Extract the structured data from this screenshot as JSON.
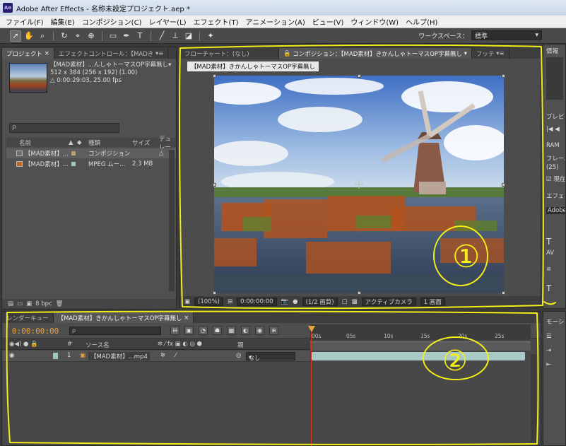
{
  "window": {
    "title": "Adobe After Effects - 名称未設定プロジェクト.aep *",
    "app_icon": "Ae"
  },
  "menu": [
    "ファイル(F)",
    "編集(E)",
    "コンポジション(C)",
    "レイヤー(L)",
    "エフェクト(T)",
    "アニメーション(A)",
    "ビュー(V)",
    "ウィンドウ(W)",
    "ヘルプ(H)"
  ],
  "toolbar": {
    "tools": [
      "selection-arrow",
      "hand",
      "zoom",
      "rotate",
      "camera",
      "pan-behind",
      "rectangle-mask",
      "pen",
      "text",
      "brush",
      "clone-stamp",
      "eraser",
      "puppet-pin"
    ],
    "workspace_label": "ワークスペース：",
    "workspace_value": "標準"
  },
  "project": {
    "tabs": [
      "プロジェクト",
      "エフェクトコントロール：【MADき"
    ],
    "selected_item": "【MAD素材】...んしゃトーマスOP字幕無し▾",
    "selected_dims": "512 x 384  (256 x 192) (1.00)",
    "selected_duration": "△ 0:00:29:03, 25.00 fps",
    "search_placeholder": "ρ",
    "columns": [
      "名前",
      "種類",
      "サイズ",
      "デュレー"
    ],
    "items": [
      {
        "name": "【MAD素材】...",
        "type": "コンポジション",
        "size": "",
        "dur": "△",
        "selected": true,
        "label_color": "#b8a06a"
      },
      {
        "name": "【MAD素材】...",
        "type": "MPEG ムー...",
        "size": "2.3 MB",
        "dur": "",
        "selected": false,
        "label_color": "#9fc7c4"
      }
    ],
    "bpc": "8 bpc"
  },
  "composition": {
    "tabs": [
      "フローチャート：(なし)",
      "コンポジション：【MAD素材】きかんしゃトーマスOP字幕無し",
      "フッテ"
    ],
    "comp_name": "【MAD素材】きかんしゃトーマスOP字幕無し",
    "footer": {
      "zoom": "(100%)",
      "timecode": "0:00:00:00",
      "resolution": "(1/2 画質)",
      "camera": "アクティブカメラ",
      "views": "1 画面"
    }
  },
  "right_panel": {
    "info_label": "情報",
    "preview_label": "プレビ",
    "ram_label": "RAM",
    "frame_label": "フレーム",
    "frame_value": "(25)",
    "current_label": "現在",
    "effects_label": "エフェ",
    "effects_value": "Adobe",
    "motion_label": "モーシ"
  },
  "timeline": {
    "tabs": [
      "レンダーキュー",
      "【MAD素材】きかんしゃトーマスOP字幕無し"
    ],
    "timecode": "0:00:00:00",
    "search_placeholder": "ρ",
    "ruler_ticks": [
      "00s",
      "05s",
      "10s",
      "15s",
      "20s",
      "25s"
    ],
    "columns": {
      "hash": "#",
      "source_name": "ソース名",
      "parent": "親"
    },
    "layers": [
      {
        "index": "1",
        "name": "【MAD素材】...mp4",
        "parent": "なし",
        "label_color": "#9fc7c4"
      }
    ]
  },
  "annotations": {
    "label_1": "①",
    "label_2": "②",
    "color": "#f2ee1a"
  }
}
